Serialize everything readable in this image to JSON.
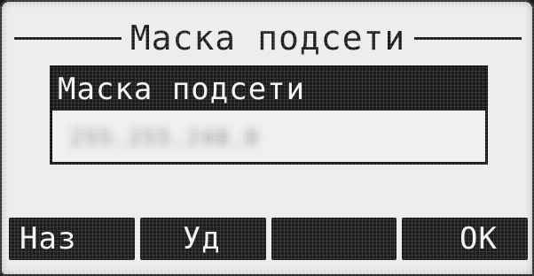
{
  "screen": {
    "title": "Маска подсети"
  },
  "field": {
    "label": "Маска подсети",
    "value": "255.255.248.0"
  },
  "softkeys": [
    {
      "label": "Наз"
    },
    {
      "label": "Уд"
    },
    {
      "label": ""
    },
    {
      "label": "OK"
    }
  ]
}
